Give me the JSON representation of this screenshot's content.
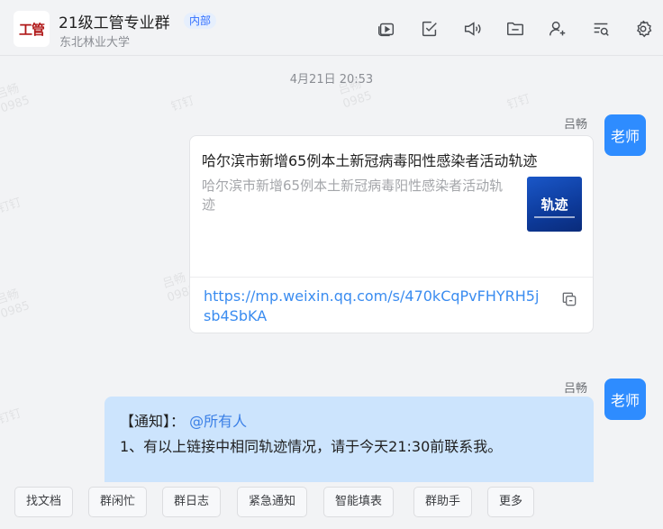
{
  "header": {
    "group_avatar_text": "工管",
    "title": "21级工管专业群",
    "badge": "内部",
    "subtitle": "东北林业大学",
    "icons": [
      "video-icon",
      "todo-check-icon",
      "announce-icon",
      "folder-icon",
      "add-member-icon",
      "search-records-icon",
      "settings-icon"
    ]
  },
  "watermark": {
    "name": "吕畅",
    "id": "0985",
    "brand": "钉钉"
  },
  "chat": {
    "timestamp": "4月21日 20:53",
    "messages": [
      {
        "sender": "吕畅",
        "avatar_text": "老师",
        "type": "link_card",
        "card": {
          "title": "哈尔滨市新增65例本土新冠病毒阳性感染者活动轨迹",
          "description": "哈尔滨市新增65例本土新冠病毒阳性感染者活动轨迹",
          "thumb_text": "轨迹",
          "url": "https://mp.weixin.qq.com/s/470kCqPvFHYRH5jsb4SbKA"
        }
      },
      {
        "sender": "吕畅",
        "avatar_text": "老师",
        "type": "notice",
        "notice": {
          "prefix": "【通知】：",
          "mention": "@所有人",
          "line2": "1、有以上链接中相同轨迹情况，请于今天21:30前联系我。"
        }
      }
    ]
  },
  "actions": [
    "找文档",
    "群闲忙",
    "群日志",
    "紧急通知",
    "智能填表",
    "群助手",
    "更多"
  ],
  "colors": {
    "accent": "#3370ff",
    "avatar_blue": "#2e8cff",
    "notice_bg": "#cce4fd",
    "link": "#3a8cf0"
  }
}
